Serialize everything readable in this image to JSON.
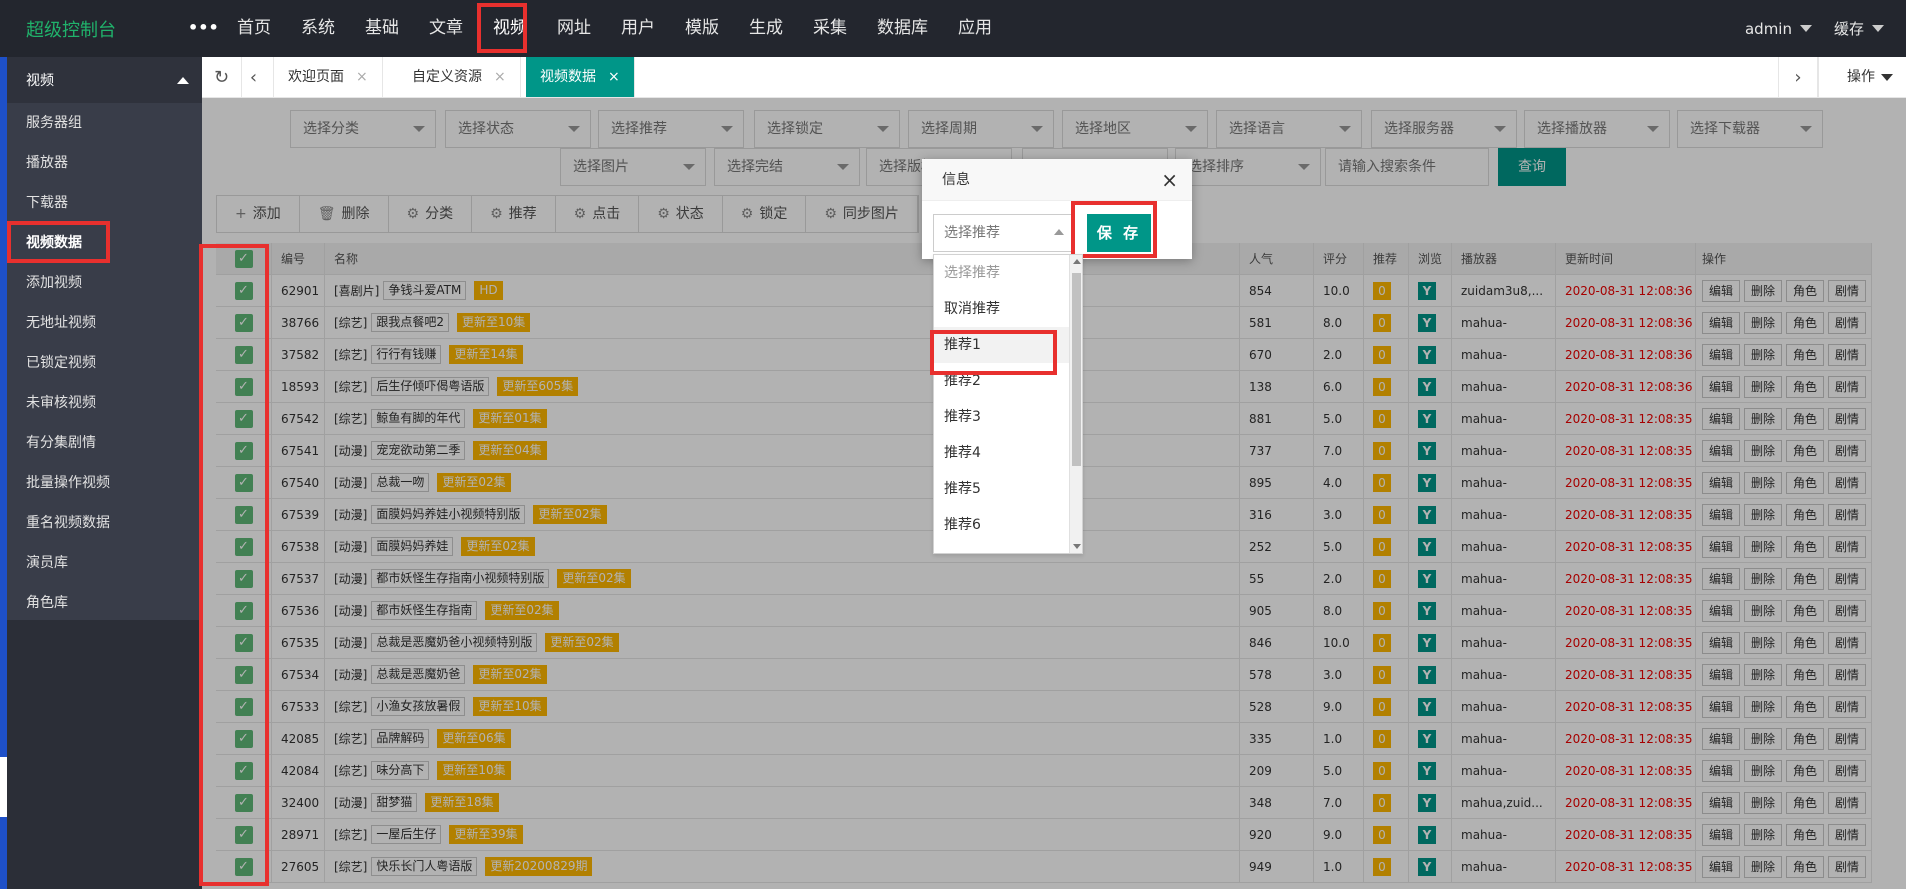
{
  "brand": "超级控制台",
  "more": "•••",
  "top_nav": [
    "首页",
    "系统",
    "基础",
    "文章",
    "视频",
    "网址",
    "用户",
    "模版",
    "生成",
    "采集",
    "数据库",
    "应用"
  ],
  "user": {
    "name": "admin",
    "cache": "缓存"
  },
  "sidebar": {
    "title": "视频",
    "items": [
      "服务器组",
      "播放器",
      "下载器",
      "视频数据",
      "添加视频",
      "无地址视频",
      "已锁定视频",
      "未审核视频",
      "有分集剧情",
      "批量操作视频",
      "重名视频数据",
      "演员库",
      "角色库"
    ]
  },
  "tabs": [
    {
      "label": "欢迎页面"
    },
    {
      "label": "自定义资源"
    },
    {
      "label": "视频数据"
    }
  ],
  "tab_ops": "操作",
  "filters_row1": [
    "选择分类",
    "选择状态",
    "选择推荐",
    "选择锁定",
    "选择周期",
    "选择地区",
    "选择语言",
    "选择服务器",
    "选择播放器",
    "选择下载器"
  ],
  "filters_row2": [
    "选择图片",
    "选择完结",
    "选择版权",
    "",
    "选择排序"
  ],
  "search_placeholder": "请输入搜索条件",
  "query": "查询",
  "toolbar": [
    "添加",
    "删除",
    "分类",
    "推荐",
    "点击",
    "状态",
    "锁定",
    "同步图片"
  ],
  "table": {
    "headers": [
      "编号",
      "名称",
      "人气",
      "评分",
      "推荐",
      "浏览",
      "播放器",
      "更新时间",
      "操作"
    ],
    "ops": [
      "编辑",
      "删除",
      "角色",
      "剧情"
    ],
    "rows": [
      {
        "id": "62901",
        "type": "[喜剧片]",
        "name": "争钱斗爱ATM",
        "badge": "HD",
        "pop": "854",
        "score": "10.0",
        "rec": "0",
        "view": "Y",
        "player": "zuidam3u8,...",
        "time": "2020-08-31 12:08:36"
      },
      {
        "id": "38766",
        "type": "[综艺]",
        "name": "跟我点餐吧2",
        "badge": "更新至10集",
        "pop": "581",
        "score": "8.0",
        "rec": "0",
        "view": "Y",
        "player": "mahua-",
        "time": "2020-08-31 12:08:36"
      },
      {
        "id": "37582",
        "type": "[综艺]",
        "name": "行行有钱赚",
        "badge": "更新至14集",
        "pop": "670",
        "score": "2.0",
        "rec": "0",
        "view": "Y",
        "player": "mahua-",
        "time": "2020-08-31 12:08:36"
      },
      {
        "id": "18593",
        "type": "[综艺]",
        "name": "后生仔倾吓偈粤语版",
        "badge": "更新至605集",
        "pop": "138",
        "score": "6.0",
        "rec": "0",
        "view": "Y",
        "player": "mahua-",
        "time": "2020-08-31 12:08:36"
      },
      {
        "id": "67542",
        "type": "[综艺]",
        "name": "鲸鱼有脚的年代",
        "badge": "更新至01集",
        "pop": "881",
        "score": "5.0",
        "rec": "0",
        "view": "Y",
        "player": "mahua-",
        "time": "2020-08-31 12:08:35"
      },
      {
        "id": "67541",
        "type": "[动漫]",
        "name": "宠宠欲动第二季",
        "badge": "更新至04集",
        "pop": "737",
        "score": "7.0",
        "rec": "0",
        "view": "Y",
        "player": "mahua-",
        "time": "2020-08-31 12:08:35"
      },
      {
        "id": "67540",
        "type": "[动漫]",
        "name": "总裁一吻",
        "badge": "更新至02集",
        "pop": "895",
        "score": "4.0",
        "rec": "0",
        "view": "Y",
        "player": "mahua-",
        "time": "2020-08-31 12:08:35"
      },
      {
        "id": "67539",
        "type": "[动漫]",
        "name": "面膜妈妈养娃小视频特别版",
        "badge": "更新至02集",
        "pop": "316",
        "score": "3.0",
        "rec": "0",
        "view": "Y",
        "player": "mahua-",
        "time": "2020-08-31 12:08:35"
      },
      {
        "id": "67538",
        "type": "[动漫]",
        "name": "面膜妈妈养娃",
        "badge": "更新至02集",
        "pop": "252",
        "score": "5.0",
        "rec": "0",
        "view": "Y",
        "player": "mahua-",
        "time": "2020-08-31 12:08:35"
      },
      {
        "id": "67537",
        "type": "[动漫]",
        "name": "都市妖怪生存指南小视频特别版",
        "badge": "更新至02集",
        "pop": "55",
        "score": "2.0",
        "rec": "0",
        "view": "Y",
        "player": "mahua-",
        "time": "2020-08-31 12:08:35"
      },
      {
        "id": "67536",
        "type": "[动漫]",
        "name": "都市妖怪生存指南",
        "badge": "更新至02集",
        "pop": "905",
        "score": "8.0",
        "rec": "0",
        "view": "Y",
        "player": "mahua-",
        "time": "2020-08-31 12:08:35"
      },
      {
        "id": "67535",
        "type": "[动漫]",
        "name": "总裁是恶魔奶爸小视频特别版",
        "badge": "更新至02集",
        "pop": "846",
        "score": "10.0",
        "rec": "0",
        "view": "Y",
        "player": "mahua-",
        "time": "2020-08-31 12:08:35"
      },
      {
        "id": "67534",
        "type": "[动漫]",
        "name": "总裁是恶魔奶爸",
        "badge": "更新至02集",
        "pop": "578",
        "score": "3.0",
        "rec": "0",
        "view": "Y",
        "player": "mahua-",
        "time": "2020-08-31 12:08:35"
      },
      {
        "id": "67533",
        "type": "[综艺]",
        "name": "小渔女孩放暑假",
        "badge": "更新至10集",
        "pop": "528",
        "score": "9.0",
        "rec": "0",
        "view": "Y",
        "player": "mahua-",
        "time": "2020-08-31 12:08:35"
      },
      {
        "id": "42085",
        "type": "[综艺]",
        "name": "品牌解码",
        "badge": "更新至06集",
        "pop": "335",
        "score": "1.0",
        "rec": "0",
        "view": "Y",
        "player": "mahua-",
        "time": "2020-08-31 12:08:35"
      },
      {
        "id": "42084",
        "type": "[综艺]",
        "name": "味分高下",
        "badge": "更新至10集",
        "pop": "209",
        "score": "5.0",
        "rec": "0",
        "view": "Y",
        "player": "mahua-",
        "time": "2020-08-31 12:08:35"
      },
      {
        "id": "32400",
        "type": "[动漫]",
        "name": "甜梦猫",
        "badge": "更新至18集",
        "pop": "348",
        "score": "7.0",
        "rec": "0",
        "view": "Y",
        "player": "mahua,zuid...",
        "time": "2020-08-31 12:08:35"
      },
      {
        "id": "28971",
        "type": "[综艺]",
        "name": "一屋后生仔",
        "badge": "更新至39集",
        "pop": "920",
        "score": "9.0",
        "rec": "0",
        "view": "Y",
        "player": "mahua-",
        "time": "2020-08-31 12:08:35"
      },
      {
        "id": "27605",
        "type": "[综艺]",
        "name": "快乐长门人粤语版",
        "badge": "更新20200829期",
        "pop": "949",
        "score": "1.0",
        "rec": "0",
        "view": "Y",
        "player": "mahua-",
        "time": "2020-08-31 12:08:35"
      }
    ]
  },
  "dialog": {
    "title": "信息",
    "select_placeholder": "选择推荐",
    "save": "保 存",
    "options": [
      "选择推荐",
      "取消推荐",
      "推荐1",
      "推荐2",
      "推荐3",
      "推荐4",
      "推荐5",
      "推荐6"
    ]
  },
  "colors": {
    "accent": "#009688",
    "highlight": "#e8302e",
    "badge": "#ffb800",
    "brand": "#20b26b",
    "check": "#5fb878"
  }
}
